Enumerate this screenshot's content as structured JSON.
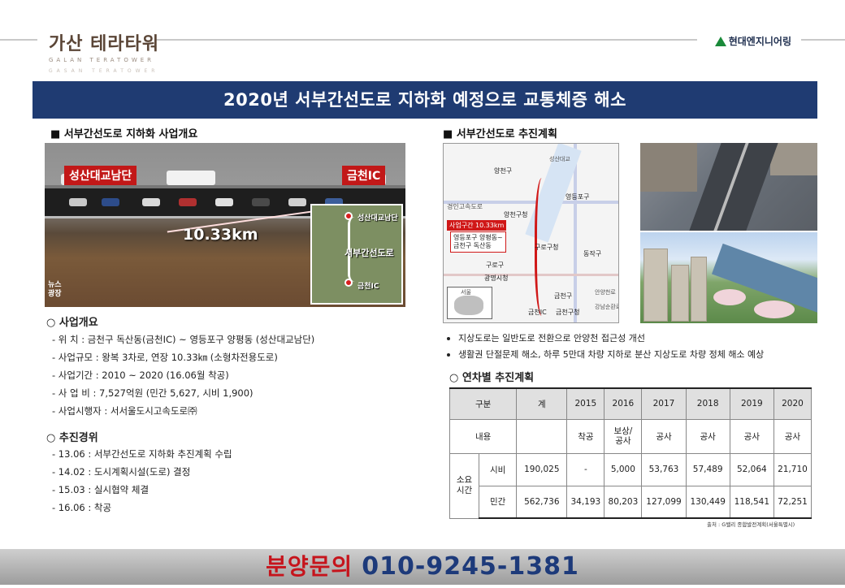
{
  "brand": {
    "title": "가산 테라타워",
    "subtitle": "GALAN TERATOWER",
    "subtitle2": "GASAN TERATOWER"
  },
  "company": {
    "name": "현대엔지니어링"
  },
  "banner": {
    "title": "2020년 서부간선도로 지하화 예정으로 교통체증 해소"
  },
  "left_section": {
    "title": "■ 서부간선도로 지하화 사업개요",
    "image": {
      "sign_left": "성산대교남단",
      "sign_right": "금천IC",
      "distance": "10.33km",
      "map_top": "성산대교남단",
      "map_middle": "서부간선도로",
      "map_bottom": "금천IC",
      "logo": "뉴스\n광장"
    },
    "overview_title": "○ 사업개요",
    "overview": [
      "- 위      치  :  금천구 독산동(금천IC) ~ 영등포구 양평동 (성산대교남단)",
      "- 사업규모  :  왕복 3차로, 연장 10.33㎞ (소형차전용도로)",
      "- 사업기간  :   2010 ~ 2020 (16.06월 착공)",
      "- 사 업  비  :  7,527억원 (민간 5,627, 시비 1,900)",
      "-  사업시행자  :  서서울도시고속도로㈜"
    ],
    "history_title": "○ 추진경위",
    "history": [
      "- 13.06  :   서부간선도로 지하화 추진계획 수립",
      "- 14.02  :   도시계획시설(도로) 결정",
      "- 15.03  :   실시협약 체결",
      "- 16.06  :   착공"
    ]
  },
  "right_section": {
    "title": "■ 서부간선도로 추진계획",
    "map": {
      "labels": [
        "양천구",
        "영등포구",
        "구로구청",
        "동작구",
        "구로구",
        "광명시청",
        "금천구",
        "금천구청",
        "금천IC",
        "양천구청",
        "경인고속도로",
        "서울",
        "안양천로",
        "성산대교",
        "강남순환로"
      ],
      "box_label": "사업구간 10.33km",
      "box_text": "영등포구 양평동~\n금천구 독산동"
    },
    "bullets": [
      "지상도로는 일반도로 전환으로 안양천 접근성 개선",
      "생활권 단절문제 해소, 하루 5만대 차량 지하로 분산 지상도로 차량 정체 해소 예상"
    ],
    "table_title": "○ 연차별 추진계획",
    "table": {
      "header": [
        "구분",
        "계",
        "2015",
        "2016",
        "2017",
        "2018",
        "2019",
        "2020"
      ],
      "content_label": "내용",
      "content": [
        "",
        "착공",
        "보상/\n공사",
        "공사",
        "공사",
        "공사",
        "공사"
      ],
      "cost_label": "소요\n시간",
      "rows": [
        {
          "label": "시비",
          "values": [
            "190,025",
            "-",
            "5,000",
            "53,763",
            "57,489",
            "52,064",
            "21,710"
          ]
        },
        {
          "label": "민간",
          "values": [
            "562,736",
            "34,193",
            "80,203",
            "127,099",
            "130,449",
            "118,541",
            "72,251"
          ]
        }
      ]
    },
    "source": "출처 : G밸리 종합발전계획(서울특별시)"
  },
  "footer": {
    "label": "분양문의",
    "phone": "010-9245-1381"
  }
}
